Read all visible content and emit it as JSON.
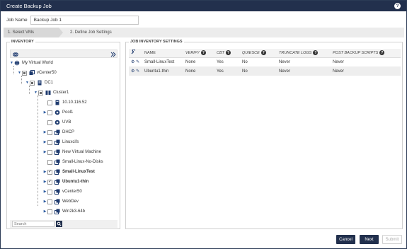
{
  "window": {
    "title": "Create Backup Job"
  },
  "job": {
    "name_label": "Job Name",
    "name_value": "Backup Job 1"
  },
  "steps": [
    {
      "label": "1. Select VMs"
    },
    {
      "label": "2. Define Job Settings"
    }
  ],
  "inventory": {
    "title": "INVENTORY",
    "tree": [
      {
        "label": "My Virtual World",
        "icon": "world-icon"
      },
      {
        "label": "vCenter50",
        "icon": "vcenter-icon"
      },
      {
        "label": "DC1",
        "icon": "datacenter-icon"
      },
      {
        "label": "Cluster1",
        "icon": "cluster-icon"
      },
      {
        "label": "10.10.116.52",
        "icon": "host-icon"
      },
      {
        "label": "Pool1",
        "icon": "pool-icon"
      },
      {
        "label": "UVB",
        "icon": "pool-icon"
      },
      {
        "label": "DHCP",
        "icon": "vm-icon"
      },
      {
        "label": "Linuxcifs",
        "icon": "vm-icon"
      },
      {
        "label": "New Virtual Machine",
        "icon": "vm-icon"
      },
      {
        "label": "Small-Linux-No-Disks",
        "icon": "vm-icon"
      },
      {
        "label": "Small-LinuxTest",
        "icon": "vm-icon"
      },
      {
        "label": "Ubuntu1-thin",
        "icon": "vm-icon"
      },
      {
        "label": "vCenter50",
        "icon": "vm-icon"
      },
      {
        "label": "WebDev",
        "icon": "vm-icon"
      },
      {
        "label": "Win2k3-64b",
        "icon": "vm-icon"
      }
    ],
    "search_placeholder": "Search"
  },
  "job_settings": {
    "title": "JOB INVENTORY SETTINGS",
    "columns": [
      "NAME",
      "VERIFY",
      "CBT",
      "QUIESCE",
      "TRUNCATE LOGS",
      "POST BACKUP SCRIPTS"
    ],
    "rows": [
      {
        "name": "Small-LinuxTest",
        "verify": "None",
        "cbt": "Yes",
        "quiesce": "No",
        "truncate": "Never",
        "post": "Never"
      },
      {
        "name": "Ubuntu1-thin",
        "verify": "None",
        "cbt": "Yes",
        "quiesce": "No",
        "truncate": "Never",
        "post": "Never"
      }
    ]
  },
  "buttons": {
    "cancel": "Cancel",
    "next": "Next",
    "submit": "Submit"
  },
  "colors": {
    "titlebar": "#22304d",
    "accent": "#2a5aa0"
  }
}
